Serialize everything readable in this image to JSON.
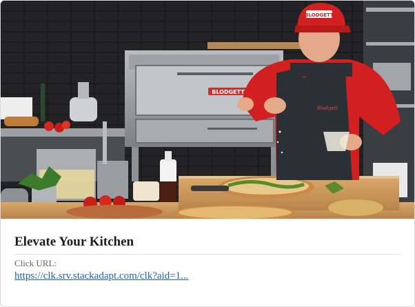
{
  "ad": {
    "title": "Elevate Your Kitchen",
    "click_url_label": "Click URL:",
    "click_url": "https://clk.srv.stackadapt.com/clk?aid=1..."
  },
  "image": {
    "oven_brand": "BLODGETT",
    "cap_text": "BLODGETT",
    "apron_text": "Blodgett"
  }
}
